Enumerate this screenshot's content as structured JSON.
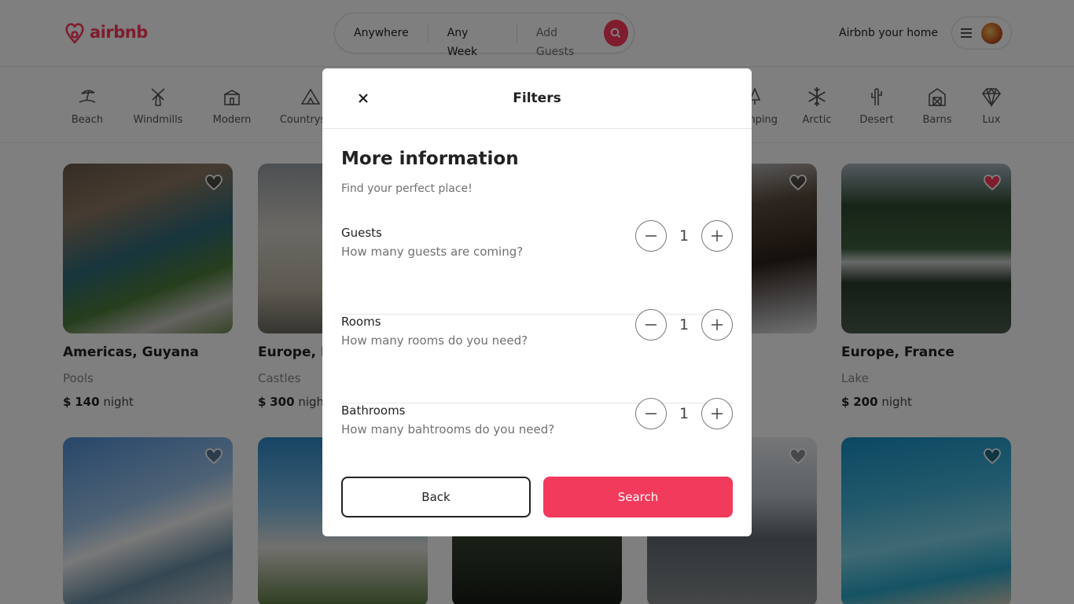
{
  "brand": {
    "name": "airbnb",
    "color": "#ff385c"
  },
  "search": {
    "where": "Anywhere",
    "when": "Any Week",
    "guests": "Add Guests",
    "icon": "search-icon"
  },
  "header": {
    "host_link": "Airbnb your home",
    "menu_icon": "hamburger-icon",
    "avatar_icon": "avatar"
  },
  "categories": [
    {
      "label": "Beach",
      "icon": "beach-icon"
    },
    {
      "label": "Windmills",
      "icon": "windmill-icon"
    },
    {
      "label": "Modern",
      "icon": "modern-icon"
    },
    {
      "label": "Countryside",
      "icon": "mountain-icon"
    },
    {
      "label": "Camping",
      "icon": "tree-icon"
    },
    {
      "label": "Arctic",
      "icon": "snowflake-icon"
    },
    {
      "label": "Desert",
      "icon": "cactus-icon"
    },
    {
      "label": "Barns",
      "icon": "barn-icon"
    },
    {
      "label": "Lux",
      "icon": "diamond-icon"
    }
  ],
  "listings": [
    {
      "title": "Americas, Guyana",
      "category": "Pools",
      "currency": "$",
      "price": "140",
      "unit": "night",
      "favorited": false
    },
    {
      "title": "Europe, Po",
      "category": "Castles",
      "currency": "$",
      "price": "300",
      "unit": "night",
      "favorited": false
    },
    {
      "title": "",
      "category": "",
      "currency": "",
      "price": "",
      "unit": "",
      "favorited": false
    },
    {
      "title": "",
      "category": "",
      "currency": "",
      "price": "",
      "unit": "",
      "favorited": false
    },
    {
      "title": "Europe, France",
      "category": "Lake",
      "currency": "$",
      "price": "200",
      "unit": "night",
      "favorited": true
    }
  ],
  "modal": {
    "title": "Filters",
    "heading": "More information",
    "subheading": "Find your perfect place!",
    "close_icon": "close-icon",
    "rows": [
      {
        "label": "Guests",
        "description": "How many guests are coming?",
        "value": "1"
      },
      {
        "label": "Rooms",
        "description": "How many rooms do you need?",
        "value": "1"
      },
      {
        "label": "Bathrooms",
        "description": "How many bahtrooms do you need?",
        "value": "1"
      }
    ],
    "back_label": "Back",
    "search_label": "Search",
    "accent": "#f23a5c"
  }
}
